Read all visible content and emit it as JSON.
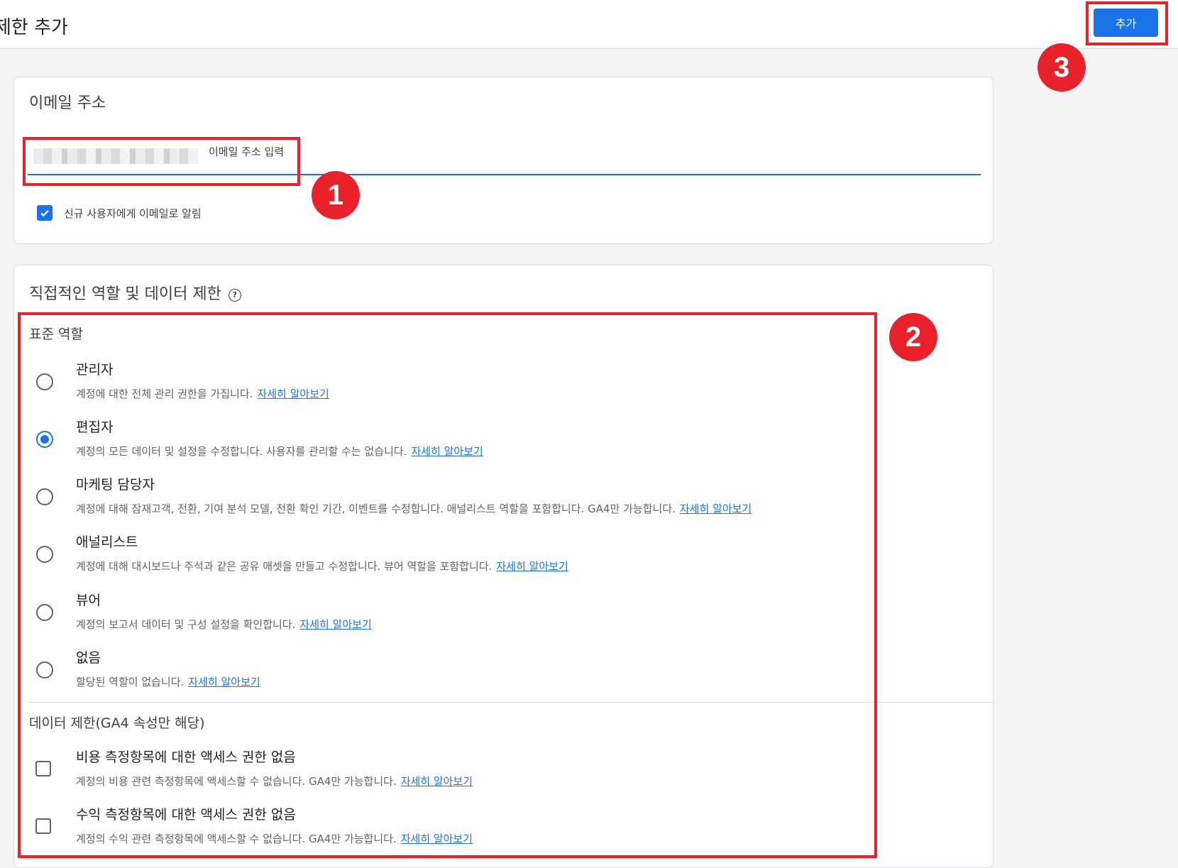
{
  "header": {
    "title": "제한 추가",
    "add_label": "추가"
  },
  "email_card": {
    "title": "이메일 주소",
    "input_placeholder": "이메일 주소 입력",
    "notify_label": "신규 사용자에게 이메일로 알림",
    "notify_checked": true
  },
  "role_card": {
    "title": "직접적인 역할 및 데이터 제한",
    "help_icon": "question-circle-icon",
    "standard_roles_label": "표준 역할",
    "learn_more": "자세히 알아보기",
    "roles": [
      {
        "name": "관리자",
        "desc": "계정에 대한 전체 관리 권한을 가집니다.",
        "selected": false
      },
      {
        "name": "편집자",
        "desc": "계정의 모든 데이터 및 설정을 수정합니다. 사용자를 관리할 수는 없습니다.",
        "selected": true
      },
      {
        "name": "마케팅 담당자",
        "desc": "계정에 대해 잠재고객, 전환, 기여 분석 모델, 전환 확인 기간, 이벤트를 수정합니다. 애널리스트 역할을 포함합니다. GA4만 가능합니다.",
        "selected": false
      },
      {
        "name": "애널리스트",
        "desc": "계정에 대해 대시보드나 주석과 같은 공유 애셋을 만들고 수정합니다. 뷰어 역할을 포함합니다.",
        "selected": false
      },
      {
        "name": "뷰어",
        "desc": "계정의 보고서 데이터 및 구성 설정을 확인합니다.",
        "selected": false
      },
      {
        "name": "없음",
        "desc": "할당된 역할이 없습니다.",
        "selected": false
      }
    ],
    "data_restrictions_label": "데이터 제한(GA4 속성만 해당)",
    "restrictions": [
      {
        "name": "비용 측정항목에 대한 액세스 권한 없음",
        "desc": "계정의 비용 관련 측정항목에 액세스할 수 없습니다. GA4만 가능합니다.",
        "checked": false
      },
      {
        "name": "수익 측정항목에 대한 액세스 권한 없음",
        "desc": "계정의 수익 관련 측정항목에 액세스할 수 없습니다. GA4만 가능합니다.",
        "checked": false
      }
    ]
  },
  "annotations": {
    "step1": "1",
    "step2": "2",
    "step3": "3",
    "highlight_color": "#e8212b"
  },
  "colors": {
    "accent": "#1a73e8",
    "background": "#f1f3f4"
  }
}
